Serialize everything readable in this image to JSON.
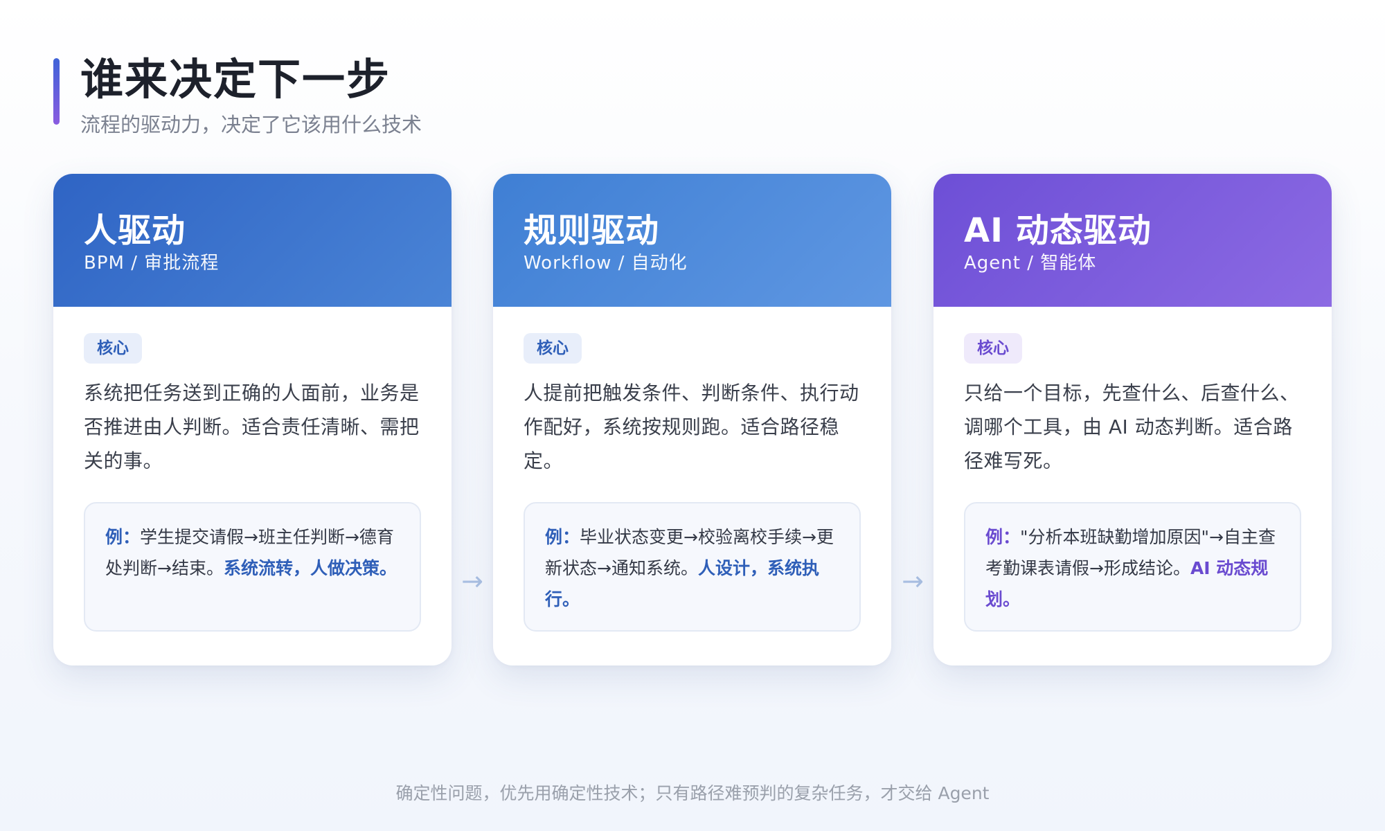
{
  "header": {
    "title": "谁来决定下一步",
    "subtitle": "流程的驱动力，决定了它该用什么技术"
  },
  "cards": [
    {
      "title": "人驱动",
      "subtitle": "BPM / 审批流程",
      "badge": "核心",
      "description": "系统把任务送到正确的人面前，业务是否推进由人判断。适合责任清晰、需把关的事。",
      "example_label": "例：",
      "example_text": "学生提交请假→班主任判断→德育处判断→结束。",
      "example_emphasis": "系统流转，人做决策。"
    },
    {
      "title": "规则驱动",
      "subtitle": "Workflow / 自动化",
      "badge": "核心",
      "description": "人提前把触发条件、判断条件、执行动作配好，系统按规则跑。适合路径稳定。",
      "example_label": "例：",
      "example_text": "毕业状态变更→校验离校手续→更新状态→通知系统。",
      "example_emphasis": "人设计，系统执行。"
    },
    {
      "title": "AI 动态驱动",
      "subtitle": "Agent / 智能体",
      "badge": "核心",
      "description": "只给一个目标，先查什么、后查什么、调哪个工具，由 AI 动态判断。适合路径难写死。",
      "example_label": "例：",
      "example_text": "\"分析本班缺勤增加原因\"→自主查考勤课表请假→形成结论。",
      "example_emphasis": "AI 动态规划。"
    }
  ],
  "arrows": [
    "→",
    "→"
  ],
  "footer": "确定性问题，优先用确定性技术；只有路径难预判的复杂任务，才交给 Agent",
  "colors": {
    "card1_header": "#2f64c4",
    "card2_header": "#3f7fd4",
    "card3_header": "#6d4fd6",
    "accent_blue": "#2f5fb8",
    "accent_purple": "#6a4bd0"
  }
}
